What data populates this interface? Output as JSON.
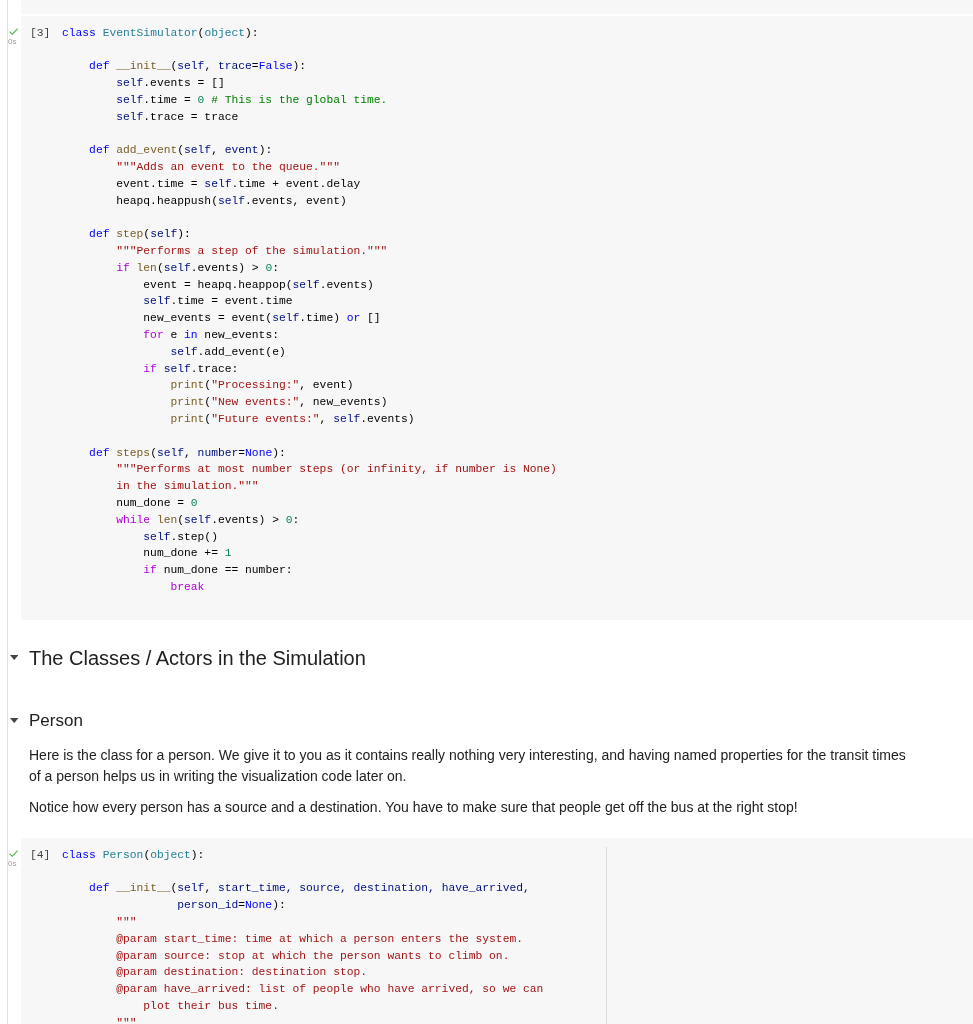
{
  "cells": [
    {
      "kind": "code",
      "execution_count": "[3]",
      "succeeded": true,
      "run_time": "0s",
      "ruler_shown": false,
      "code_blocks": [
        [
          [
            {
              "text": "class ",
              "kind": "keyword"
            },
            {
              "text": "EventSimulator",
              "kind": "type"
            },
            {
              "text": "(",
              "kind": "plain"
            },
            {
              "text": "object",
              "kind": "type"
            },
            {
              "text": "):",
              "kind": "plain"
            }
          ]
        ],
        [
          [
            {
              "text": "    def ",
              "kind": "keyword"
            },
            {
              "text": "__init__",
              "kind": "function"
            },
            {
              "text": "(",
              "kind": "plain"
            },
            {
              "text": "self",
              "kind": "self"
            },
            {
              "text": ", ",
              "kind": "plain"
            },
            {
              "text": "trace",
              "kind": "param"
            },
            {
              "text": "=",
              "kind": "plain"
            },
            {
              "text": "False",
              "kind": "keyword"
            },
            {
              "text": "):",
              "kind": "plain"
            }
          ],
          [
            {
              "text": "        self",
              "kind": "self"
            },
            {
              "text": ".events = []",
              "kind": "plain"
            }
          ],
          [
            {
              "text": "        self",
              "kind": "self"
            },
            {
              "text": ".time = ",
              "kind": "plain"
            },
            {
              "text": "0",
              "kind": "number"
            },
            {
              "text": " # This is the global time.",
              "kind": "comment"
            }
          ],
          [
            {
              "text": "        self",
              "kind": "self"
            },
            {
              "text": ".trace = trace",
              "kind": "plain"
            }
          ]
        ],
        [
          [
            {
              "text": "    def ",
              "kind": "keyword"
            },
            {
              "text": "add_event",
              "kind": "function"
            },
            {
              "text": "(",
              "kind": "plain"
            },
            {
              "text": "self",
              "kind": "self"
            },
            {
              "text": ", ",
              "kind": "plain"
            },
            {
              "text": "event",
              "kind": "param"
            },
            {
              "text": "):",
              "kind": "plain"
            }
          ],
          [
            {
              "text": "        \"\"\"Adds an event to the queue.\"\"\"",
              "kind": "string"
            }
          ],
          [
            {
              "text": "        event.time = ",
              "kind": "plain"
            },
            {
              "text": "self",
              "kind": "self"
            },
            {
              "text": ".time + event.delay",
              "kind": "plain"
            }
          ],
          [
            {
              "text": "        heapq.heappush(",
              "kind": "plain"
            },
            {
              "text": "self",
              "kind": "self"
            },
            {
              "text": ".events, event)",
              "kind": "plain"
            }
          ]
        ],
        [
          [
            {
              "text": "    def ",
              "kind": "keyword"
            },
            {
              "text": "step",
              "kind": "function"
            },
            {
              "text": "(",
              "kind": "plain"
            },
            {
              "text": "self",
              "kind": "self"
            },
            {
              "text": "):",
              "kind": "plain"
            }
          ],
          [
            {
              "text": "        \"\"\"Performs a step of the simulation.\"\"\"",
              "kind": "string"
            }
          ],
          [
            {
              "text": "        if ",
              "kind": "control"
            },
            {
              "text": "len",
              "kind": "function"
            },
            {
              "text": "(",
              "kind": "plain"
            },
            {
              "text": "self",
              "kind": "self"
            },
            {
              "text": ".events) > ",
              "kind": "plain"
            },
            {
              "text": "0",
              "kind": "number"
            },
            {
              "text": ":",
              "kind": "plain"
            }
          ],
          [
            {
              "text": "            event = heapq.heappop(",
              "kind": "plain"
            },
            {
              "text": "self",
              "kind": "self"
            },
            {
              "text": ".events)",
              "kind": "plain"
            }
          ],
          [
            {
              "text": "            self",
              "kind": "self"
            },
            {
              "text": ".time = event.time",
              "kind": "plain"
            }
          ],
          [
            {
              "text": "            new_events = event(",
              "kind": "plain"
            },
            {
              "text": "self",
              "kind": "self"
            },
            {
              "text": ".time) ",
              "kind": "plain"
            },
            {
              "text": "or",
              "kind": "keyword"
            },
            {
              "text": " []",
              "kind": "plain"
            }
          ],
          [
            {
              "text": "            for ",
              "kind": "control"
            },
            {
              "text": "e ",
              "kind": "plain"
            },
            {
              "text": "in",
              "kind": "keyword"
            },
            {
              "text": " new_events:",
              "kind": "plain"
            }
          ],
          [
            {
              "text": "                self",
              "kind": "self"
            },
            {
              "text": ".add_event(e)",
              "kind": "plain"
            }
          ],
          [
            {
              "text": "            if ",
              "kind": "control"
            },
            {
              "text": "self",
              "kind": "self"
            },
            {
              "text": ".trace:",
              "kind": "plain"
            }
          ],
          [
            {
              "text": "                print",
              "kind": "function"
            },
            {
              "text": "(",
              "kind": "plain"
            },
            {
              "text": "\"Processing:\"",
              "kind": "string"
            },
            {
              "text": ", event)",
              "kind": "plain"
            }
          ],
          [
            {
              "text": "                print",
              "kind": "function"
            },
            {
              "text": "(",
              "kind": "plain"
            },
            {
              "text": "\"New events:\"",
              "kind": "string"
            },
            {
              "text": ", new_events)",
              "kind": "plain"
            }
          ],
          [
            {
              "text": "                print",
              "kind": "function"
            },
            {
              "text": "(",
              "kind": "plain"
            },
            {
              "text": "\"Future events:\"",
              "kind": "string"
            },
            {
              "text": ", ",
              "kind": "plain"
            },
            {
              "text": "self",
              "kind": "self"
            },
            {
              "text": ".events)",
              "kind": "plain"
            }
          ]
        ],
        [
          [
            {
              "text": "    def ",
              "kind": "keyword"
            },
            {
              "text": "steps",
              "kind": "function"
            },
            {
              "text": "(",
              "kind": "plain"
            },
            {
              "text": "self",
              "kind": "self"
            },
            {
              "text": ", ",
              "kind": "plain"
            },
            {
              "text": "number",
              "kind": "param"
            },
            {
              "text": "=",
              "kind": "plain"
            },
            {
              "text": "None",
              "kind": "keyword"
            },
            {
              "text": "):",
              "kind": "plain"
            }
          ],
          [
            {
              "text": "        \"\"\"Performs at most number steps (or infinity, if number is None)",
              "kind": "string"
            }
          ],
          [
            {
              "text": "        in the simulation.\"\"\"",
              "kind": "string"
            }
          ],
          [
            {
              "text": "        num_done = ",
              "kind": "plain"
            },
            {
              "text": "0",
              "kind": "number"
            }
          ],
          [
            {
              "text": "        while ",
              "kind": "control"
            },
            {
              "text": "len",
              "kind": "function"
            },
            {
              "text": "(",
              "kind": "plain"
            },
            {
              "text": "self",
              "kind": "self"
            },
            {
              "text": ".events) > ",
              "kind": "plain"
            },
            {
              "text": "0",
              "kind": "number"
            },
            {
              "text": ":",
              "kind": "plain"
            }
          ],
          [
            {
              "text": "            self",
              "kind": "self"
            },
            {
              "text": ".step()",
              "kind": "plain"
            }
          ],
          [
            {
              "text": "            num_done += ",
              "kind": "plain"
            },
            {
              "text": "1",
              "kind": "number"
            }
          ],
          [
            {
              "text": "            if ",
              "kind": "control"
            },
            {
              "text": "num_done == number:",
              "kind": "plain"
            }
          ],
          [
            {
              "text": "                break",
              "kind": "control"
            }
          ]
        ]
      ]
    },
    {
      "kind": "heading",
      "title": "The Classes / Actors in the Simulation",
      "expanded": true
    },
    {
      "kind": "subheading",
      "title": "Person",
      "expanded": true,
      "paragraphs": [
        "Here is the class for a person. We give it to you as it contains really nothing very interesting, and having named properties for the transit times of a person helps us in writing the visualization code later on.",
        "Notice how every person has a source and a destination. You have to make sure that people get off the bus at the right stop!"
      ]
    },
    {
      "kind": "code",
      "execution_count": "[4]",
      "succeeded": true,
      "run_time": "0s",
      "ruler_shown": true,
      "code_blocks": [
        [
          [
            {
              "text": "class ",
              "kind": "keyword"
            },
            {
              "text": "Person",
              "kind": "type"
            },
            {
              "text": "(",
              "kind": "plain"
            },
            {
              "text": "object",
              "kind": "type"
            },
            {
              "text": "):",
              "kind": "plain"
            }
          ]
        ],
        [
          [
            {
              "text": "    def ",
              "kind": "keyword"
            },
            {
              "text": "__init__",
              "kind": "function"
            },
            {
              "text": "(",
              "kind": "plain"
            },
            {
              "text": "self",
              "kind": "self"
            },
            {
              "text": ", ",
              "kind": "plain"
            },
            {
              "text": "start_time, source, destination, have_arrived,",
              "kind": "param"
            }
          ],
          [
            {
              "text": "                 person_id",
              "kind": "param"
            },
            {
              "text": "=",
              "kind": "plain"
            },
            {
              "text": "None",
              "kind": "keyword"
            },
            {
              "text": "):",
              "kind": "plain"
            }
          ],
          [
            {
              "text": "        \"\"\"",
              "kind": "string"
            }
          ],
          [
            {
              "text": "        @param start_time: time at which a person enters the system.",
              "kind": "string"
            }
          ],
          [
            {
              "text": "        @param source: stop at which the person wants to climb on.",
              "kind": "string"
            }
          ],
          [
            {
              "text": "        @param destination: destination stop.",
              "kind": "string"
            }
          ],
          [
            {
              "text": "        @param have_arrived: list of people who have arrived, so we can",
              "kind": "string"
            }
          ],
          [
            {
              "text": "            plot their bus time.",
              "kind": "string"
            }
          ],
          [
            {
              "text": "        \"\"\"",
              "kind": "string"
            }
          ]
        ]
      ]
    }
  ]
}
